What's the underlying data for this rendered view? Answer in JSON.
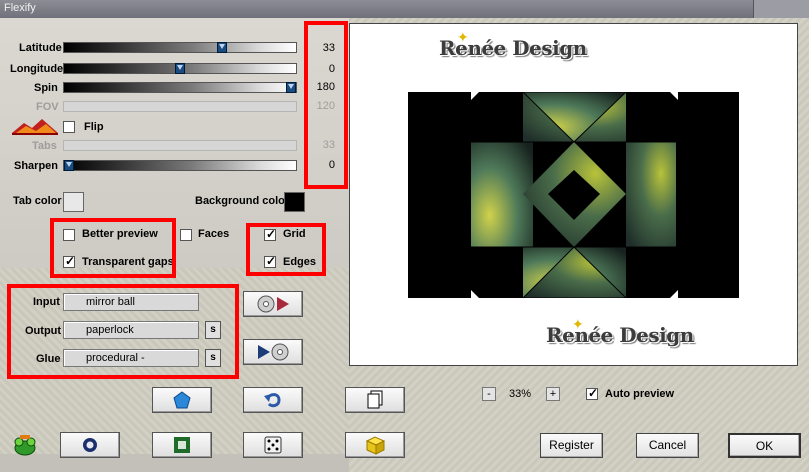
{
  "window": {
    "title": "Flexify"
  },
  "params": {
    "latitude": {
      "label": "Latitude",
      "value": "33",
      "level": 0.69
    },
    "longitude": {
      "label": "Longitude",
      "value": "0",
      "level": 0.5
    },
    "spin": {
      "label": "Spin",
      "value": "180",
      "level": 1.0
    },
    "fov": {
      "label": "FOV",
      "value": "120"
    },
    "flip": {
      "label": "Flip",
      "checked": false
    },
    "tabs": {
      "label": "Tabs",
      "value": "33"
    },
    "sharpen": {
      "label": "Sharpen",
      "value": "0",
      "level": 0.0
    }
  },
  "colors": {
    "tab_color_label": "Tab color",
    "tab_color": "#e8e8e8",
    "background_color_label": "Background color",
    "background_color": "#000000",
    "highlight": "#ff0000"
  },
  "options": {
    "better_preview": {
      "label": "Better preview",
      "checked": false
    },
    "faces": {
      "label": "Faces",
      "checked": false
    },
    "grid": {
      "label": "Grid",
      "checked": true
    },
    "transparent_gaps": {
      "label": "Transparent gaps",
      "checked": true
    },
    "edges": {
      "label": "Edges",
      "checked": true
    }
  },
  "mapping": {
    "input": {
      "label": "Input",
      "value": "mirror ball"
    },
    "output": {
      "label": "Output",
      "value": "paperlock",
      "btn": "s"
    },
    "glue": {
      "label": "Glue",
      "value": "procedural -",
      "btn": "s"
    }
  },
  "preview": {
    "watermark_text": "Renée Design",
    "zoom": "33%",
    "zoom_minus": "-",
    "zoom_plus": "+",
    "auto_preview": "Auto preview"
  },
  "buttons": {
    "register": "Register",
    "cancel": "Cancel",
    "ok": "OK"
  },
  "icons": {
    "landscape": "mountain-sunset-icon",
    "pentagon": "pentagon-icon",
    "undo": "undo-arrow-icon",
    "copy": "copy-pages-icon",
    "ring": "ring-icon",
    "square": "square-frame-icon",
    "dice": "dice-icon",
    "cube": "yellow-cube-icon",
    "plugin": "green-frog-icon",
    "load": "disc-load-icon",
    "save": "disc-save-icon"
  }
}
